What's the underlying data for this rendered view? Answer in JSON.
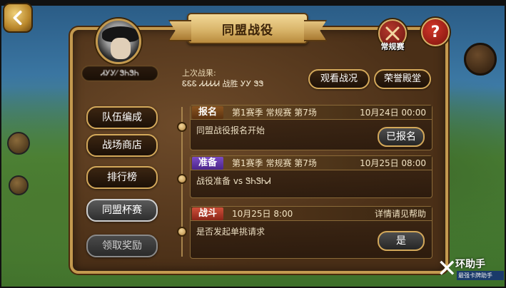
{
  "header": {
    "title": "同盟战役",
    "regular_label": "常规赛",
    "help_symbol": "?"
  },
  "player": {
    "name": "ᏗᎩᎩ⁄ ᏕᏂᏕᏂ"
  },
  "last_result": {
    "label": "上次战果:",
    "text": "ᏋᏋᏋ ᏗᏗᏗᏗᏗ  战胜  ᎩᎩ ᏕᏕ"
  },
  "actions": {
    "watch_label": "观看战况",
    "hall_label": "荣誉殿堂"
  },
  "menu": [
    {
      "label": "队伍编成",
      "state": "normal"
    },
    {
      "label": "战场商店",
      "state": "normal"
    },
    {
      "label": "排行榜",
      "state": "normal"
    },
    {
      "label": "同盟杯赛",
      "state": "active"
    },
    {
      "label": "领取奖励",
      "state": "disabled"
    }
  ],
  "events": [
    {
      "tag": "报名",
      "info": "第1赛季  常规赛  第7场",
      "time": "10月24日  00:00",
      "body": "同盟战役报名开始",
      "button": "已报名"
    },
    {
      "tag": "准备",
      "info": "第1赛季  常规赛  第7场",
      "time": "10月25日  08:00",
      "body": "战役准备  vs  ᏕᏂᏕᏂᏗ"
    },
    {
      "tag": "战斗",
      "info": "10月25日    8:00",
      "time": "详情请见帮助",
      "body": "是否发起单挑请求",
      "button": "是"
    }
  ],
  "watermark": {
    "mark": "✕",
    "title": "环助手",
    "subtitle": "最强卡牌助手"
  },
  "colors": {
    "gold_border": "#d3a85a",
    "panel_bg": "#4a2f17",
    "tag_signup": "#8a5420",
    "tag_prepare": "#7c4cc4",
    "tag_fight": "#d0503a"
  }
}
